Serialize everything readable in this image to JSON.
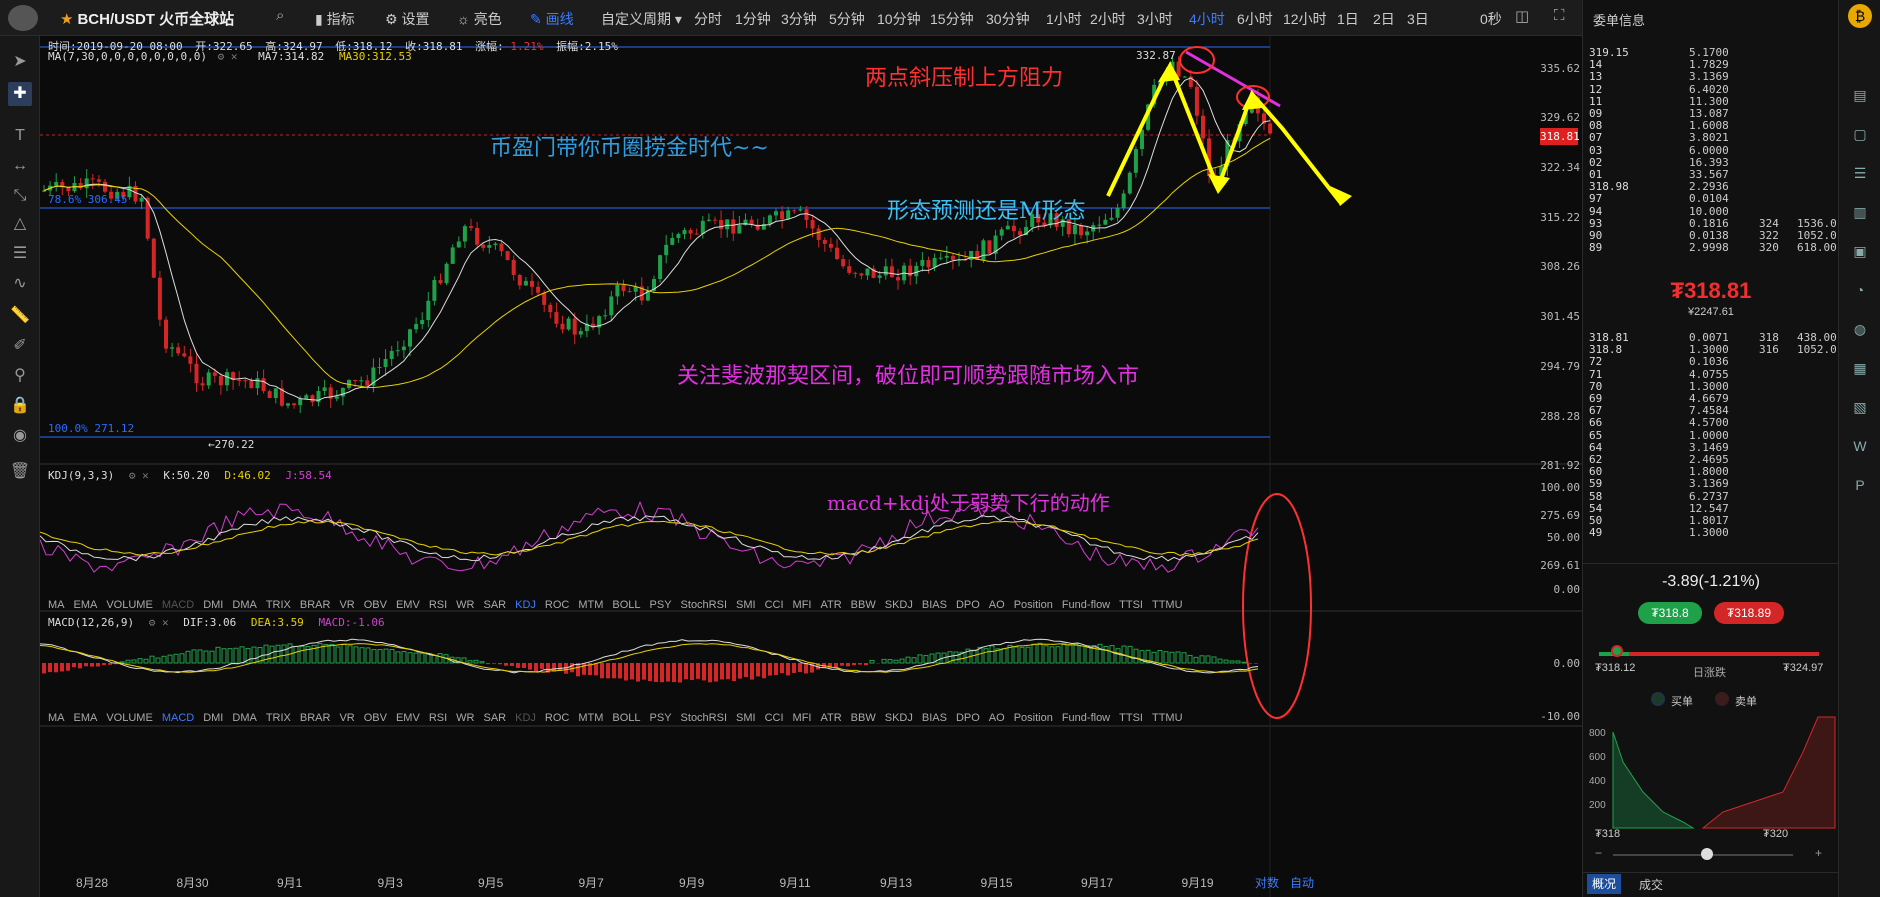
{
  "header": {
    "symbol": "BCH/USDT 火币全球站",
    "menu": [
      "指标",
      "设置",
      "亮色",
      "画线"
    ],
    "period_label": "自定义周期",
    "periods": [
      "分时",
      "1分钟",
      "3分钟",
      "5分钟",
      "10分钟",
      "15分钟",
      "30分钟",
      "1小时",
      "2小时",
      "3小时",
      "4小时",
      "6小时",
      "12小时",
      "1日",
      "2日",
      "3日"
    ],
    "active_period": "4小时",
    "countdown": "0秒"
  },
  "info": {
    "time": "时间:2019-09-20 08:00",
    "open": "开:322.65",
    "high": "高:324.97",
    "low": "低:318.12",
    "close": "收:318.81",
    "change": "涨幅:-1.21%",
    "amplitude": "振幅:2.15%",
    "ma_label": "MA(7,30,0,0,0,0,0,0,0,0)",
    "ma7": "MA7:314.82",
    "ma30": "MA30:312.53"
  },
  "y_labels": [
    "335.62",
    "329.62",
    "322.34",
    "315.22",
    "308.26",
    "301.45",
    "294.79",
    "288.28",
    "281.92",
    "275.69",
    "269.61"
  ],
  "current_price_tag": "318.81",
  "fib": {
    "level1": "78.6% 306.45",
    "level2": "100.0% 271.12"
  },
  "markers": {
    "high": "332.87",
    "low": "←270.22"
  },
  "annotations": [
    "两点斜压制上方阻力",
    "币盈门带你币圈捞金时代~~",
    "形态预测还是M形态",
    "关注斐波那契区间，破位即可顺势跟随市场入市",
    "macd+kdj处于弱势下行的动作"
  ],
  "kdj": {
    "label": "KDJ(9,3,3)",
    "k": "K:50.20",
    "d": "D:46.02",
    "j": "J:58.54",
    "y": [
      "100.00",
      "50.00",
      "0.00"
    ]
  },
  "macd": {
    "label": "MACD(12,26,9)",
    "dif": "DIF:3.06",
    "dea": "DEA:3.59",
    "macd": "MACD:-1.06",
    "y": [
      "0.00",
      "-10.00"
    ]
  },
  "indicators": [
    "MA",
    "EMA",
    "VOLUME",
    "MACD",
    "DMI",
    "DMA",
    "TRIX",
    "BRAR",
    "VR",
    "OBV",
    "EMV",
    "RSI",
    "WR",
    "SAR",
    "KDJ",
    "ROC",
    "MTM",
    "BOLL",
    "PSY",
    "StochRSI",
    "SMI",
    "CCI",
    "MFI",
    "ATR",
    "BBW",
    "SKDJ",
    "BIAS",
    "DPO",
    "AO",
    "Position",
    "Fund-flow",
    "TTSI",
    "TTMU"
  ],
  "x_labels": [
    "8月28",
    "8月30",
    "9月1",
    "9月3",
    "9月5",
    "9月7",
    "9月9",
    "9月11",
    "9月13",
    "9月15",
    "9月17",
    "9月19"
  ],
  "bottom_right": {
    "log": "对数",
    "auto": "自动"
  },
  "orderbook": {
    "title": "委单信息",
    "asks": [
      [
        "319.15",
        "5.1700",
        "",
        ""
      ],
      [
        "14",
        "1.7829",
        "",
        ""
      ],
      [
        "13",
        "3.1369",
        "",
        ""
      ],
      [
        "12",
        "6.4020",
        "",
        ""
      ],
      [
        "11",
        "11.300",
        "",
        ""
      ],
      [
        "09",
        "13.087",
        "",
        ""
      ],
      [
        "08",
        "1.6008",
        "",
        ""
      ],
      [
        "07",
        "3.8021",
        "",
        ""
      ],
      [
        "03",
        "6.0000",
        "",
        ""
      ],
      [
        "02",
        "16.393",
        "",
        ""
      ],
      [
        "01",
        "33.567",
        "",
        ""
      ],
      [
        "318.98",
        "2.2936",
        "",
        ""
      ],
      [
        "97",
        "0.0104",
        "",
        ""
      ],
      [
        "94",
        "10.000",
        "",
        ""
      ],
      [
        "93",
        "0.1816",
        "324",
        "1536.0"
      ],
      [
        "90",
        "0.0138",
        "322",
        "1052.0"
      ],
      [
        "89",
        "2.9998",
        "320",
        "618.00"
      ]
    ],
    "last_price": "₮318.81",
    "last_cny": "¥2247.61",
    "bids": [
      [
        "318.81",
        "0.0071",
        "318",
        "438.00"
      ],
      [
        "318.8",
        "1.3000",
        "316",
        "1052.0"
      ],
      [
        "72",
        "0.1036",
        "",
        ""
      ],
      [
        "71",
        "4.0755",
        "",
        ""
      ],
      [
        "70",
        "1.3000",
        "",
        ""
      ],
      [
        "69",
        "4.6679",
        "",
        ""
      ],
      [
        "67",
        "7.4584",
        "",
        ""
      ],
      [
        "66",
        "4.5700",
        "",
        ""
      ],
      [
        "65",
        "1.0000",
        "",
        ""
      ],
      [
        "64",
        "3.1469",
        "",
        ""
      ],
      [
        "62",
        "2.4695",
        "",
        ""
      ],
      [
        "60",
        "1.8000",
        "",
        ""
      ],
      [
        "59",
        "3.1369",
        "",
        ""
      ],
      [
        "58",
        "6.2737",
        "",
        ""
      ],
      [
        "54",
        "12.547",
        "",
        ""
      ],
      [
        "50",
        "1.8017",
        "",
        ""
      ],
      [
        "49",
        "1.3000",
        "",
        ""
      ]
    ],
    "change": "-3.89(-1.21%)",
    "buy_price": "₮318.8",
    "sell_price": "₮318.89",
    "range_low": "₮318.12",
    "range_mid": "日涨跌",
    "range_high": "₮324.97",
    "legend_buy": "买单",
    "legend_sell": "卖单",
    "depth_y": [
      "800",
      "600",
      "400",
      "200"
    ],
    "depth_x": [
      "₮318",
      "₮320"
    ],
    "tabs": [
      "概况",
      "成交"
    ]
  },
  "right_icons": [
    "bitcoin-icon",
    "wallet-icon",
    "doc-icon",
    "list-icon",
    "chart-icon",
    "card-icon",
    "clock-icon",
    "globe-icon",
    "book-icon",
    "calendar-icon",
    "w-icon",
    "pro-icon"
  ]
}
